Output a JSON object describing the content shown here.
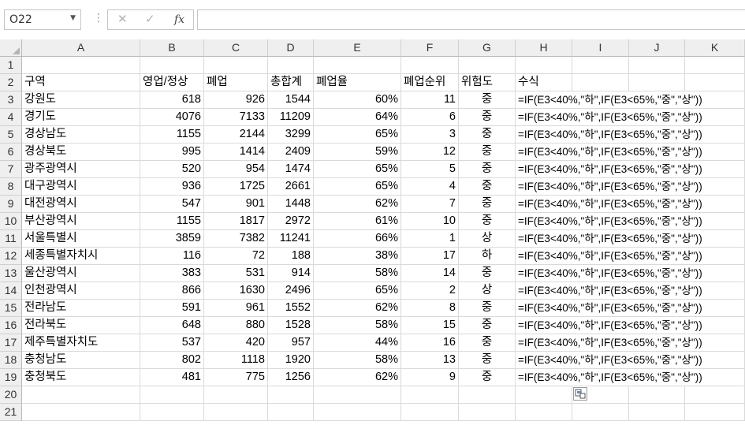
{
  "namebox": {
    "value": "O22"
  },
  "formula_bar": {
    "cancel_icon": "✕",
    "enter_icon": "✓",
    "fx_label": "fx",
    "value": ""
  },
  "columns": [
    "A",
    "B",
    "C",
    "D",
    "E",
    "F",
    "G",
    "H",
    "I",
    "J",
    "K"
  ],
  "row_numbers": [
    "1",
    "2",
    "3",
    "4",
    "5",
    "6",
    "7",
    "8",
    "9",
    "10",
    "11",
    "12",
    "13",
    "14",
    "15",
    "16",
    "17",
    "18",
    "19",
    "20",
    "21"
  ],
  "headers": [
    "구역",
    "영업/정상",
    "폐업",
    "총합계",
    "폐업율",
    "폐업순위",
    "위험도",
    "수식"
  ],
  "rows": [
    [
      "강원도",
      "618",
      "926",
      "1544",
      "60%",
      "11",
      "중",
      "=IF(E3<40%,\"하\",IF(E3<65%,\"중\",\"상\"))"
    ],
    [
      "경기도",
      "4076",
      "7133",
      "11209",
      "64%",
      "6",
      "중",
      "=IF(E3<40%,\"하\",IF(E3<65%,\"중\",\"상\"))"
    ],
    [
      "경상남도",
      "1155",
      "2144",
      "3299",
      "65%",
      "3",
      "중",
      "=IF(E3<40%,\"하\",IF(E3<65%,\"중\",\"상\"))"
    ],
    [
      "경상북도",
      "995",
      "1414",
      "2409",
      "59%",
      "12",
      "중",
      "=IF(E3<40%,\"하\",IF(E3<65%,\"중\",\"상\"))"
    ],
    [
      "광주광역시",
      "520",
      "954",
      "1474",
      "65%",
      "5",
      "중",
      "=IF(E3<40%,\"하\",IF(E3<65%,\"중\",\"상\"))"
    ],
    [
      "대구광역시",
      "936",
      "1725",
      "2661",
      "65%",
      "4",
      "중",
      "=IF(E3<40%,\"하\",IF(E3<65%,\"중\",\"상\"))"
    ],
    [
      "대전광역시",
      "547",
      "901",
      "1448",
      "62%",
      "7",
      "중",
      "=IF(E3<40%,\"하\",IF(E3<65%,\"중\",\"상\"))"
    ],
    [
      "부산광역시",
      "1155",
      "1817",
      "2972",
      "61%",
      "10",
      "중",
      "=IF(E3<40%,\"하\",IF(E3<65%,\"중\",\"상\"))"
    ],
    [
      "서울특별시",
      "3859",
      "7382",
      "11241",
      "66%",
      "1",
      "상",
      "=IF(E3<40%,\"하\",IF(E3<65%,\"중\",\"상\"))"
    ],
    [
      "세종특별자치시",
      "116",
      "72",
      "188",
      "38%",
      "17",
      "하",
      "=IF(E3<40%,\"하\",IF(E3<65%,\"중\",\"상\"))"
    ],
    [
      "울산광역시",
      "383",
      "531",
      "914",
      "58%",
      "14",
      "중",
      "=IF(E3<40%,\"하\",IF(E3<65%,\"중\",\"상\"))"
    ],
    [
      "인천광역시",
      "866",
      "1630",
      "2496",
      "65%",
      "2",
      "상",
      "=IF(E3<40%,\"하\",IF(E3<65%,\"중\",\"상\"))"
    ],
    [
      "전라남도",
      "591",
      "961",
      "1552",
      "62%",
      "8",
      "중",
      "=IF(E3<40%,\"하\",IF(E3<65%,\"중\",\"상\"))"
    ],
    [
      "전라북도",
      "648",
      "880",
      "1528",
      "58%",
      "15",
      "중",
      "=IF(E3<40%,\"하\",IF(E3<65%,\"중\",\"상\"))"
    ],
    [
      "제주특별자치도",
      "537",
      "420",
      "957",
      "44%",
      "16",
      "중",
      "=IF(E3<40%,\"하\",IF(E3<65%,\"중\",\"상\"))"
    ],
    [
      "충청남도",
      "802",
      "1118",
      "1920",
      "58%",
      "13",
      "중",
      "=IF(E3<40%,\"하\",IF(E3<65%,\"중\",\"상\"))"
    ],
    [
      "충청북도",
      "481",
      "775",
      "1256",
      "62%",
      "9",
      "중",
      "=IF(E3<40%,\"하\",IF(E3<65%,\"중\",\"상\"))"
    ]
  ],
  "icons": {
    "paste_options": "paste-options-icon"
  },
  "colors": {
    "header_bg": "#efefef",
    "gridline": "#dadada"
  }
}
